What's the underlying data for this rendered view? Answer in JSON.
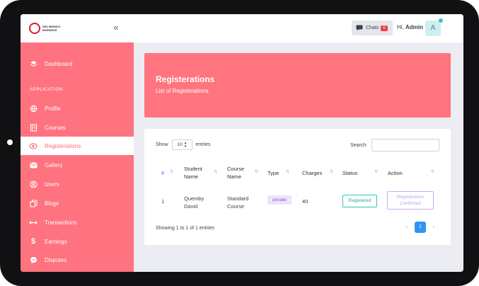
{
  "brand": {
    "logo_text": "DRJ BEHIN'S BUSINESS"
  },
  "sidebar": {
    "section_label": "APPLICATION",
    "items": [
      {
        "label": "Dashboard",
        "icon": "dashboard-icon"
      },
      {
        "label": "Profile",
        "icon": "globe-icon"
      },
      {
        "label": "Courses",
        "icon": "book-icon"
      },
      {
        "label": "Registerations",
        "icon": "eye-icon",
        "active": true
      },
      {
        "label": "Gallery",
        "icon": "mail-icon"
      },
      {
        "label": "Users",
        "icon": "user-icon"
      },
      {
        "label": "Blogs",
        "icon": "copy-icon"
      },
      {
        "label": "Transactions",
        "icon": "transfer-icon"
      },
      {
        "label": "Earnings",
        "icon": "dollar-icon"
      },
      {
        "label": "Disputes",
        "icon": "chat-icon"
      }
    ]
  },
  "header": {
    "chats_label": "Chats",
    "chats_count": "0",
    "greeting": "Hi,",
    "user_name": "Admin",
    "avatar_letter": "A"
  },
  "banner": {
    "title": "Registerations",
    "subtitle": "List of Registerations"
  },
  "table": {
    "show_label": "Show",
    "page_size": "10",
    "entries_label": "entries",
    "search_label": "Search:",
    "columns": [
      "#",
      "Student Name",
      "Course Name",
      "Type",
      "Charges",
      "Status",
      "Action"
    ],
    "rows": [
      {
        "num": "1",
        "student": "Quemby David",
        "course": "Standard Course",
        "type": "private",
        "charges": "40",
        "status": "Registered",
        "action": "Registeration Confirmed"
      }
    ],
    "info": "Showing 1 to 1 of 1 entries",
    "pagination": {
      "prev": "‹",
      "current": "1",
      "next": "›"
    }
  },
  "colors": {
    "accent": "#ff727f",
    "primary": "#2f94f2"
  }
}
